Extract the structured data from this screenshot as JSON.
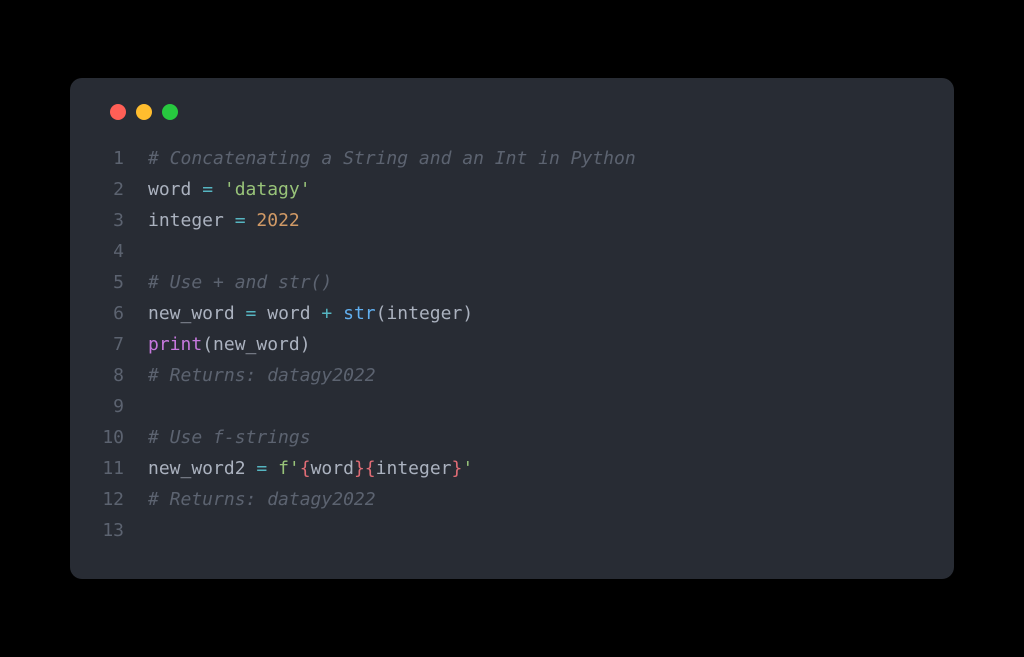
{
  "window": {
    "traffic_lights": [
      "close",
      "minimize",
      "maximize"
    ]
  },
  "code": {
    "lines": [
      {
        "num": "1",
        "tokens": [
          {
            "cls": "t-comment",
            "text": "# Concatenating a String and an Int in Python"
          }
        ]
      },
      {
        "num": "2",
        "tokens": [
          {
            "cls": "t-plain",
            "text": "word "
          },
          {
            "cls": "t-assign",
            "text": "="
          },
          {
            "cls": "t-plain",
            "text": " "
          },
          {
            "cls": "t-string",
            "text": "'datagy'"
          }
        ]
      },
      {
        "num": "3",
        "tokens": [
          {
            "cls": "t-plain",
            "text": "integer "
          },
          {
            "cls": "t-assign",
            "text": "="
          },
          {
            "cls": "t-plain",
            "text": " "
          },
          {
            "cls": "t-number",
            "text": "2022"
          }
        ]
      },
      {
        "num": "4",
        "tokens": []
      },
      {
        "num": "5",
        "tokens": [
          {
            "cls": "t-comment",
            "text": "# Use + and str()"
          }
        ]
      },
      {
        "num": "6",
        "tokens": [
          {
            "cls": "t-plain",
            "text": "new_word "
          },
          {
            "cls": "t-assign",
            "text": "="
          },
          {
            "cls": "t-plain",
            "text": " word "
          },
          {
            "cls": "t-assign",
            "text": "+"
          },
          {
            "cls": "t-plain",
            "text": " "
          },
          {
            "cls": "t-func",
            "text": "str"
          },
          {
            "cls": "t-plain",
            "text": "(integer)"
          }
        ]
      },
      {
        "num": "7",
        "tokens": [
          {
            "cls": "t-builtin",
            "text": "print"
          },
          {
            "cls": "t-plain",
            "text": "(new_word)"
          }
        ]
      },
      {
        "num": "8",
        "tokens": [
          {
            "cls": "t-comment",
            "text": "# Returns: datagy2022"
          }
        ]
      },
      {
        "num": "9",
        "tokens": []
      },
      {
        "num": "10",
        "tokens": [
          {
            "cls": "t-comment",
            "text": "# Use f-strings"
          }
        ]
      },
      {
        "num": "11",
        "tokens": [
          {
            "cls": "t-plain",
            "text": "new_word2 "
          },
          {
            "cls": "t-assign",
            "text": "="
          },
          {
            "cls": "t-plain",
            "text": " "
          },
          {
            "cls": "t-string",
            "text": "f'"
          },
          {
            "cls": "t-fstring-brace",
            "text": "{"
          },
          {
            "cls": "t-plain",
            "text": "word"
          },
          {
            "cls": "t-fstring-brace",
            "text": "}{"
          },
          {
            "cls": "t-plain",
            "text": "integer"
          },
          {
            "cls": "t-fstring-brace",
            "text": "}"
          },
          {
            "cls": "t-string",
            "text": "'"
          }
        ]
      },
      {
        "num": "12",
        "tokens": [
          {
            "cls": "t-comment",
            "text": "# Returns: datagy2022"
          }
        ]
      },
      {
        "num": "13",
        "tokens": []
      }
    ]
  }
}
